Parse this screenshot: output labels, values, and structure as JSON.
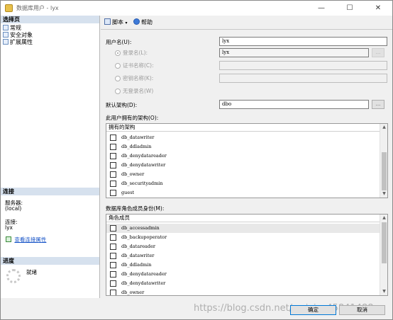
{
  "window": {
    "title": "数据库用户 - lyx",
    "minimize_glyph": "—",
    "maximize_glyph": "☐",
    "close_glyph": "✕"
  },
  "left": {
    "select_page_header": "选择页",
    "pages": [
      "常规",
      "安全对象",
      "扩展属性"
    ],
    "connection_header": "连接",
    "server_label": "服务器:",
    "server_value": "(local)",
    "connection_label": "连接:",
    "connection_value": "lyx",
    "view_connection_link": "查看连接属性",
    "progress_header": "进度",
    "progress_status": "就绪"
  },
  "toolbar": {
    "script_label": "脚本",
    "help_label": "帮助"
  },
  "form": {
    "username_label": "用户名(U):",
    "username_value": "lyx",
    "login_name_label": "登录名(L):",
    "login_name_value": "lyx",
    "cert_name_label": "证书名称(C):",
    "key_name_label": "密钥名称(K):",
    "no_login_label": "无登录名(W)",
    "default_schema_label": "默认架构(D):",
    "default_schema_value": "dbo",
    "browse_label": "..."
  },
  "owned_schemas": {
    "section_label": "此用户拥有的架构(O):",
    "column_header": "拥有的架构",
    "items": [
      "db_datawriter",
      "db_ddladmin",
      "db_denydatareader",
      "db_denydatawriter",
      "db_owner",
      "db_securityadmin",
      "guest"
    ]
  },
  "role_membership": {
    "section_label": "数据库角色成员身份(M):",
    "column_header": "角色成员",
    "items": [
      "db_accessadmin",
      "db_backupoperator",
      "db_datareader",
      "db_datawriter",
      "db_ddladmin",
      "db_denydatareader",
      "db_denydatawriter",
      "db_owner"
    ]
  },
  "buttons": {
    "ok_label": "确定",
    "cancel_label": "取消"
  },
  "watermark": "https://blog.csdn.net/weixin_45841488"
}
